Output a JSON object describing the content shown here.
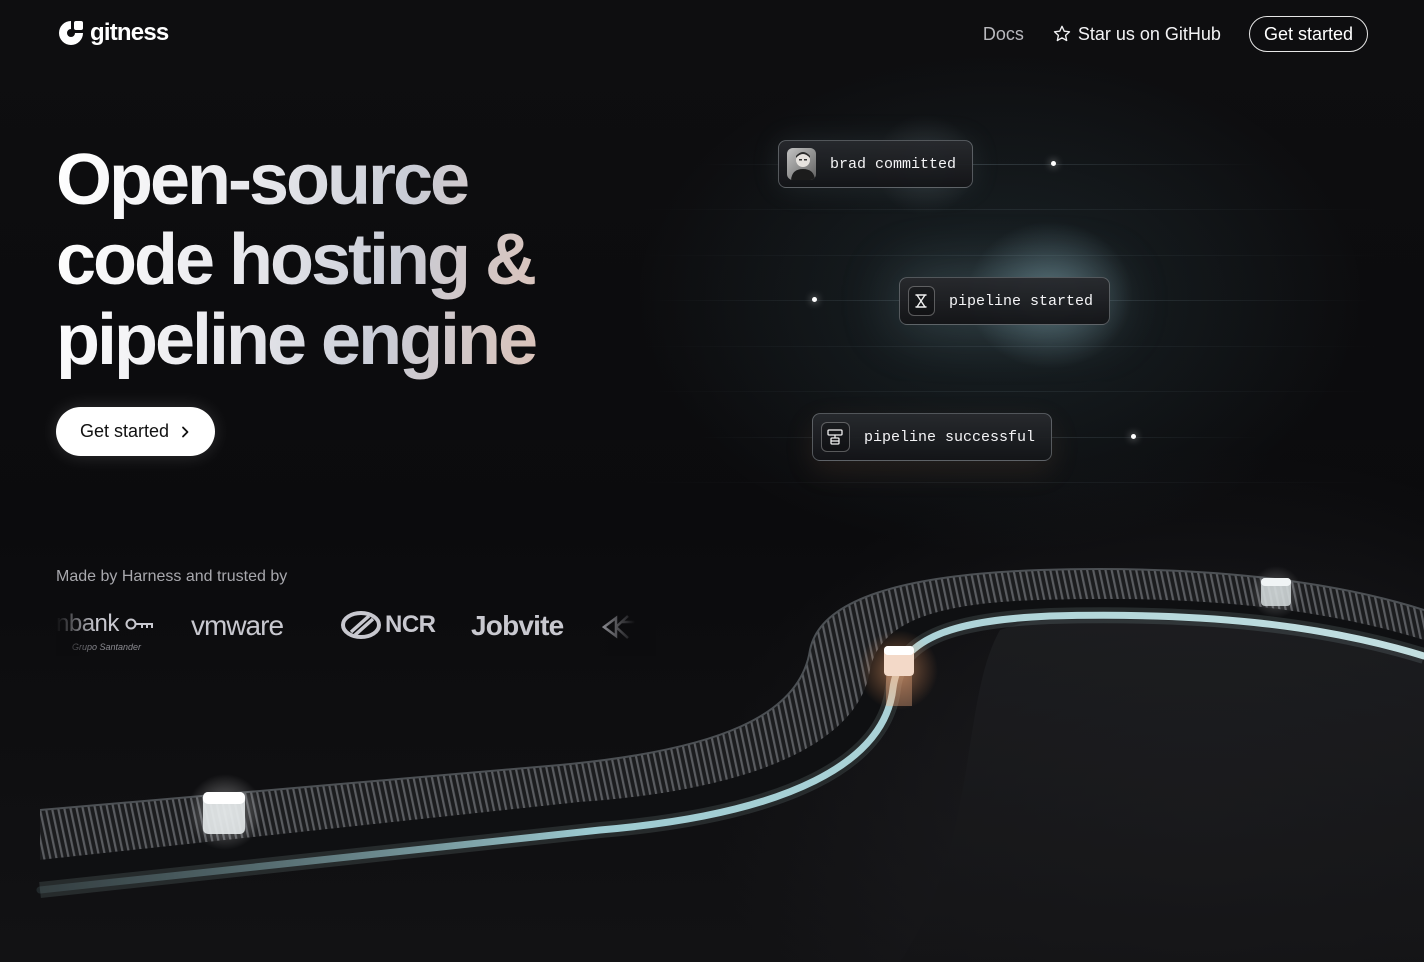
{
  "brand": {
    "name": "gitness"
  },
  "nav": {
    "docs": "Docs",
    "github": "Star us on GitHub",
    "cta": "Get started"
  },
  "hero": {
    "title_lines": [
      "Open-source",
      "code hosting &",
      "pipeline engine"
    ],
    "cta": "Get started"
  },
  "trusted": {
    "label": "Made by Harness and trusted by",
    "logos": [
      {
        "name": "openbank",
        "text": "nbank",
        "subtext": "Grupo Santander"
      },
      {
        "name": "vmware",
        "text": "vmware"
      },
      {
        "name": "ncr",
        "text": "NCR"
      },
      {
        "name": "jobvite",
        "text": "Jobvite"
      }
    ]
  },
  "events": [
    {
      "text": "brad committed",
      "icon": "avatar"
    },
    {
      "text": "pipeline started",
      "icon": "hourglass-icon"
    },
    {
      "text": "pipeline successful",
      "icon": "pipeline-icon"
    }
  ],
  "colors": {
    "background": "#0b0b0d",
    "accent_glow": "#a8dce6",
    "warm_glow": "#f0b890"
  }
}
